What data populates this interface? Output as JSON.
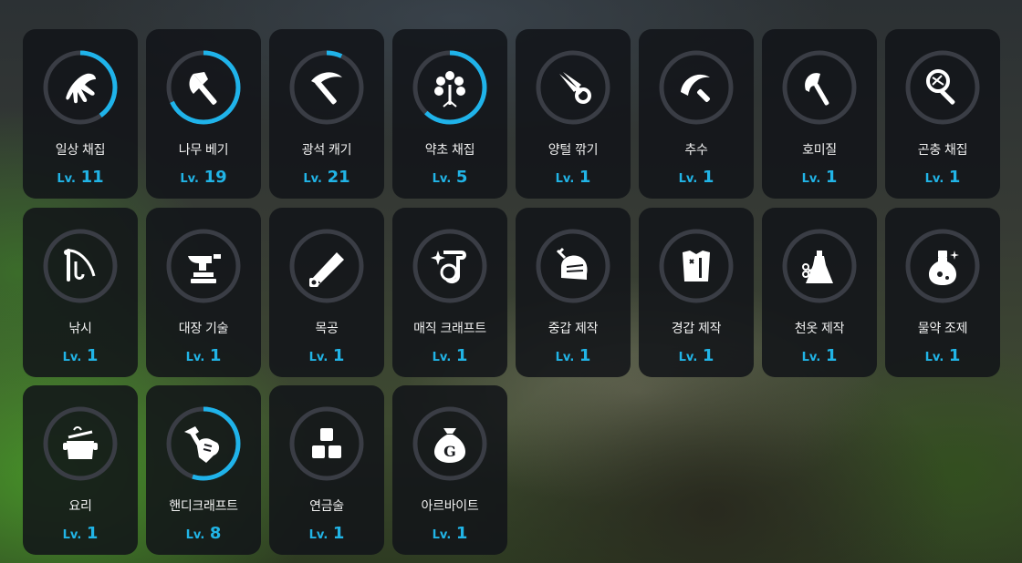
{
  "skills": [
    {
      "name": "일상 채집",
      "level_prefix": "Lv.",
      "level": "11",
      "progress": 0.4,
      "icon": "glove-hand-icon"
    },
    {
      "name": "나무 베기",
      "level_prefix": "Lv.",
      "level": "19",
      "progress": 0.68,
      "icon": "axe-icon"
    },
    {
      "name": "광석 캐기",
      "level_prefix": "Lv.",
      "level": "21",
      "progress": 0.07,
      "icon": "pickaxe-icon"
    },
    {
      "name": "약초 채집",
      "level_prefix": "Lv.",
      "level": "5",
      "progress": 0.62,
      "icon": "herb-icon"
    },
    {
      "name": "양털 깎기",
      "level_prefix": "Lv.",
      "level": "1",
      "progress": 0,
      "icon": "shears-icon"
    },
    {
      "name": "추수",
      "level_prefix": "Lv.",
      "level": "1",
      "progress": 0,
      "icon": "sickle-icon"
    },
    {
      "name": "호미질",
      "level_prefix": "Lv.",
      "level": "1",
      "progress": 0,
      "icon": "hoe-icon"
    },
    {
      "name": "곤충 채집",
      "level_prefix": "Lv.",
      "level": "1",
      "progress": 0,
      "icon": "bug-net-icon"
    },
    {
      "name": "낚시",
      "level_prefix": "Lv.",
      "level": "1",
      "progress": 0,
      "icon": "fishing-rod-icon"
    },
    {
      "name": "대장 기술",
      "level_prefix": "Lv.",
      "level": "1",
      "progress": 0,
      "icon": "anvil-icon"
    },
    {
      "name": "목공",
      "level_prefix": "Lv.",
      "level": "1",
      "progress": 0,
      "icon": "saw-icon"
    },
    {
      "name": "매직 크래프트",
      "level_prefix": "Lv.",
      "level": "1",
      "progress": 0,
      "icon": "magic-scroll-icon"
    },
    {
      "name": "중갑 제작",
      "level_prefix": "Lv.",
      "level": "1",
      "progress": 0,
      "icon": "knight-helmet-icon"
    },
    {
      "name": "경갑 제작",
      "level_prefix": "Lv.",
      "level": "1",
      "progress": 0,
      "icon": "leather-armor-icon"
    },
    {
      "name": "천옷 제작",
      "level_prefix": "Lv.",
      "level": "1",
      "progress": 0,
      "icon": "dress-icon"
    },
    {
      "name": "물약 조제",
      "level_prefix": "Lv.",
      "level": "1",
      "progress": 0,
      "icon": "potion-icon"
    },
    {
      "name": "요리",
      "level_prefix": "Lv.",
      "level": "1",
      "progress": 0,
      "icon": "cooking-pot-icon"
    },
    {
      "name": "핸디크래프트",
      "level_prefix": "Lv.",
      "level": "8",
      "progress": 0.55,
      "icon": "hammer-fist-icon"
    },
    {
      "name": "연금술",
      "level_prefix": "Lv.",
      "level": "1",
      "progress": 0,
      "icon": "alchemy-blocks-icon"
    },
    {
      "name": "아르바이트",
      "level_prefix": "Lv.",
      "level": "1",
      "progress": 0,
      "icon": "money-bag-icon"
    }
  ],
  "colors": {
    "ring_track": "#3a3d45",
    "ring_progress": "#1fb3ea",
    "level_text": "#21b4e6"
  }
}
